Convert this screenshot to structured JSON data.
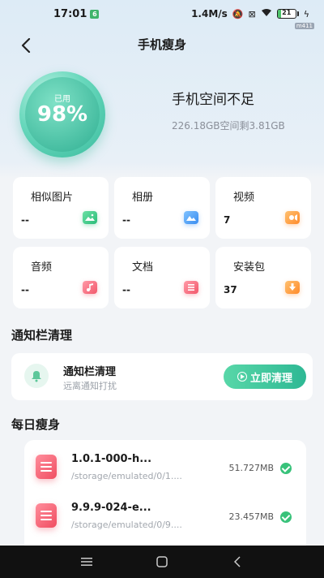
{
  "status": {
    "time": "17:01",
    "notification_badge": "6",
    "speed": "1.4M/s",
    "battery": "21",
    "battery_level": 0.21,
    "corner_tag": "m411"
  },
  "header": {
    "title": "手机瘦身"
  },
  "storage": {
    "used_label": "已用",
    "used_percent": "98%",
    "headline": "手机空间不足",
    "detail": "226.18GB空间剩3.81GB"
  },
  "categories": [
    {
      "label": "相似图片",
      "value": "--",
      "icon": "image-icon",
      "color": "#2bbc79"
    },
    {
      "label": "相册",
      "value": "--",
      "icon": "photo-album-icon",
      "color": "#3a8df0"
    },
    {
      "label": "视频",
      "value": "7",
      "icon": "video-icon",
      "color": "#ff8a2a"
    },
    {
      "label": "音频",
      "value": "--",
      "icon": "music-icon",
      "color": "#f2576b"
    },
    {
      "label": "文档",
      "value": "--",
      "icon": "document-icon",
      "color": "#f2576b"
    },
    {
      "label": "安装包",
      "value": "37",
      "icon": "package-icon",
      "color": "#ff8a2a"
    }
  ],
  "notify": {
    "section_title": "通知栏清理",
    "card_title": "通知栏清理",
    "card_subtitle": "远离通知打扰",
    "button_label": "立即清理"
  },
  "daily": {
    "section_title": "每日瘦身",
    "files": [
      {
        "name": "1.0.1-000-h...",
        "path": "/storage/emulated/0/1....",
        "size": "51.727MB"
      },
      {
        "name": "9.9.9-024-e...",
        "path": "/storage/emulated/0/9....",
        "size": "23.457MB"
      }
    ]
  },
  "nav": {
    "menu": "≡",
    "home": "▢",
    "back": "‹"
  }
}
